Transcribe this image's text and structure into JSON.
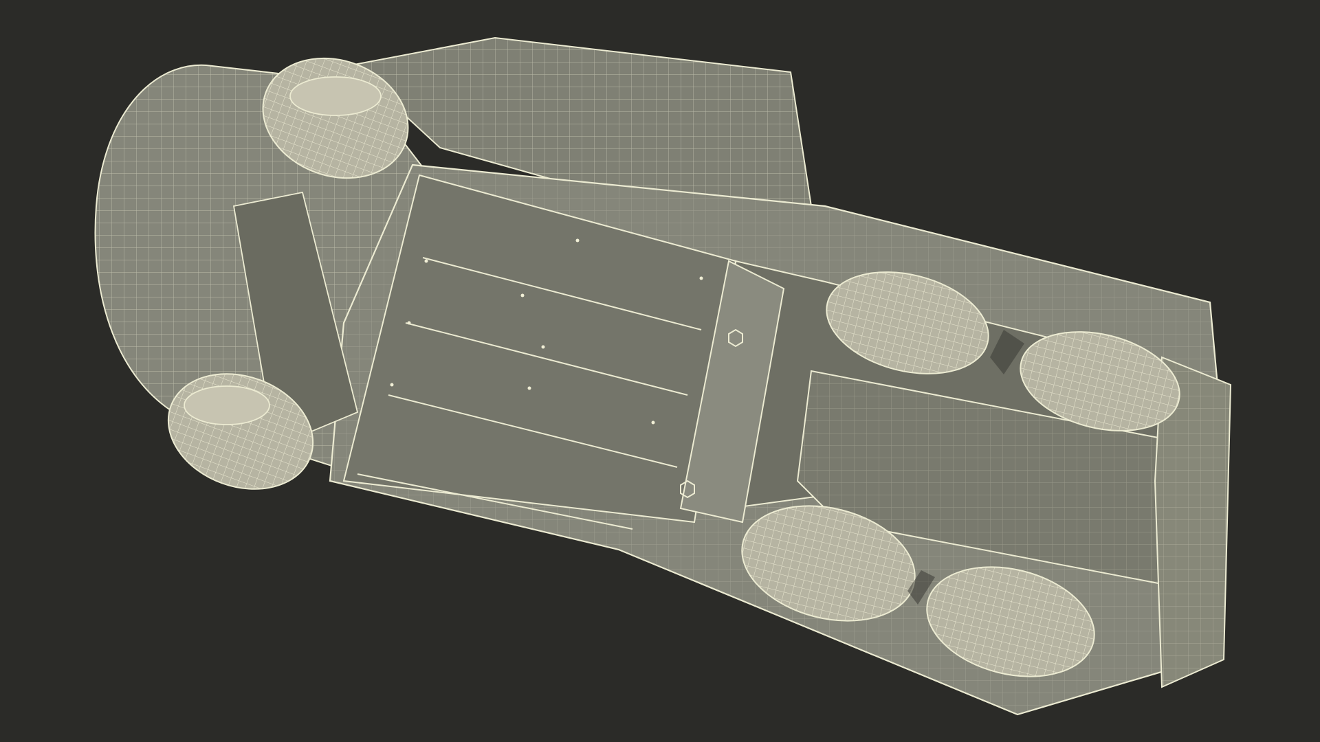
{
  "scene": {
    "subject": "wireframe-truck-underside",
    "colors": {
      "background": "#2b2b28",
      "body_fill": "#85867a",
      "body_shade": "#6e6f64",
      "panel_dark": "#5f6056",
      "wire": "#ecebd2",
      "tire_fill": "#b6b4a2"
    }
  }
}
